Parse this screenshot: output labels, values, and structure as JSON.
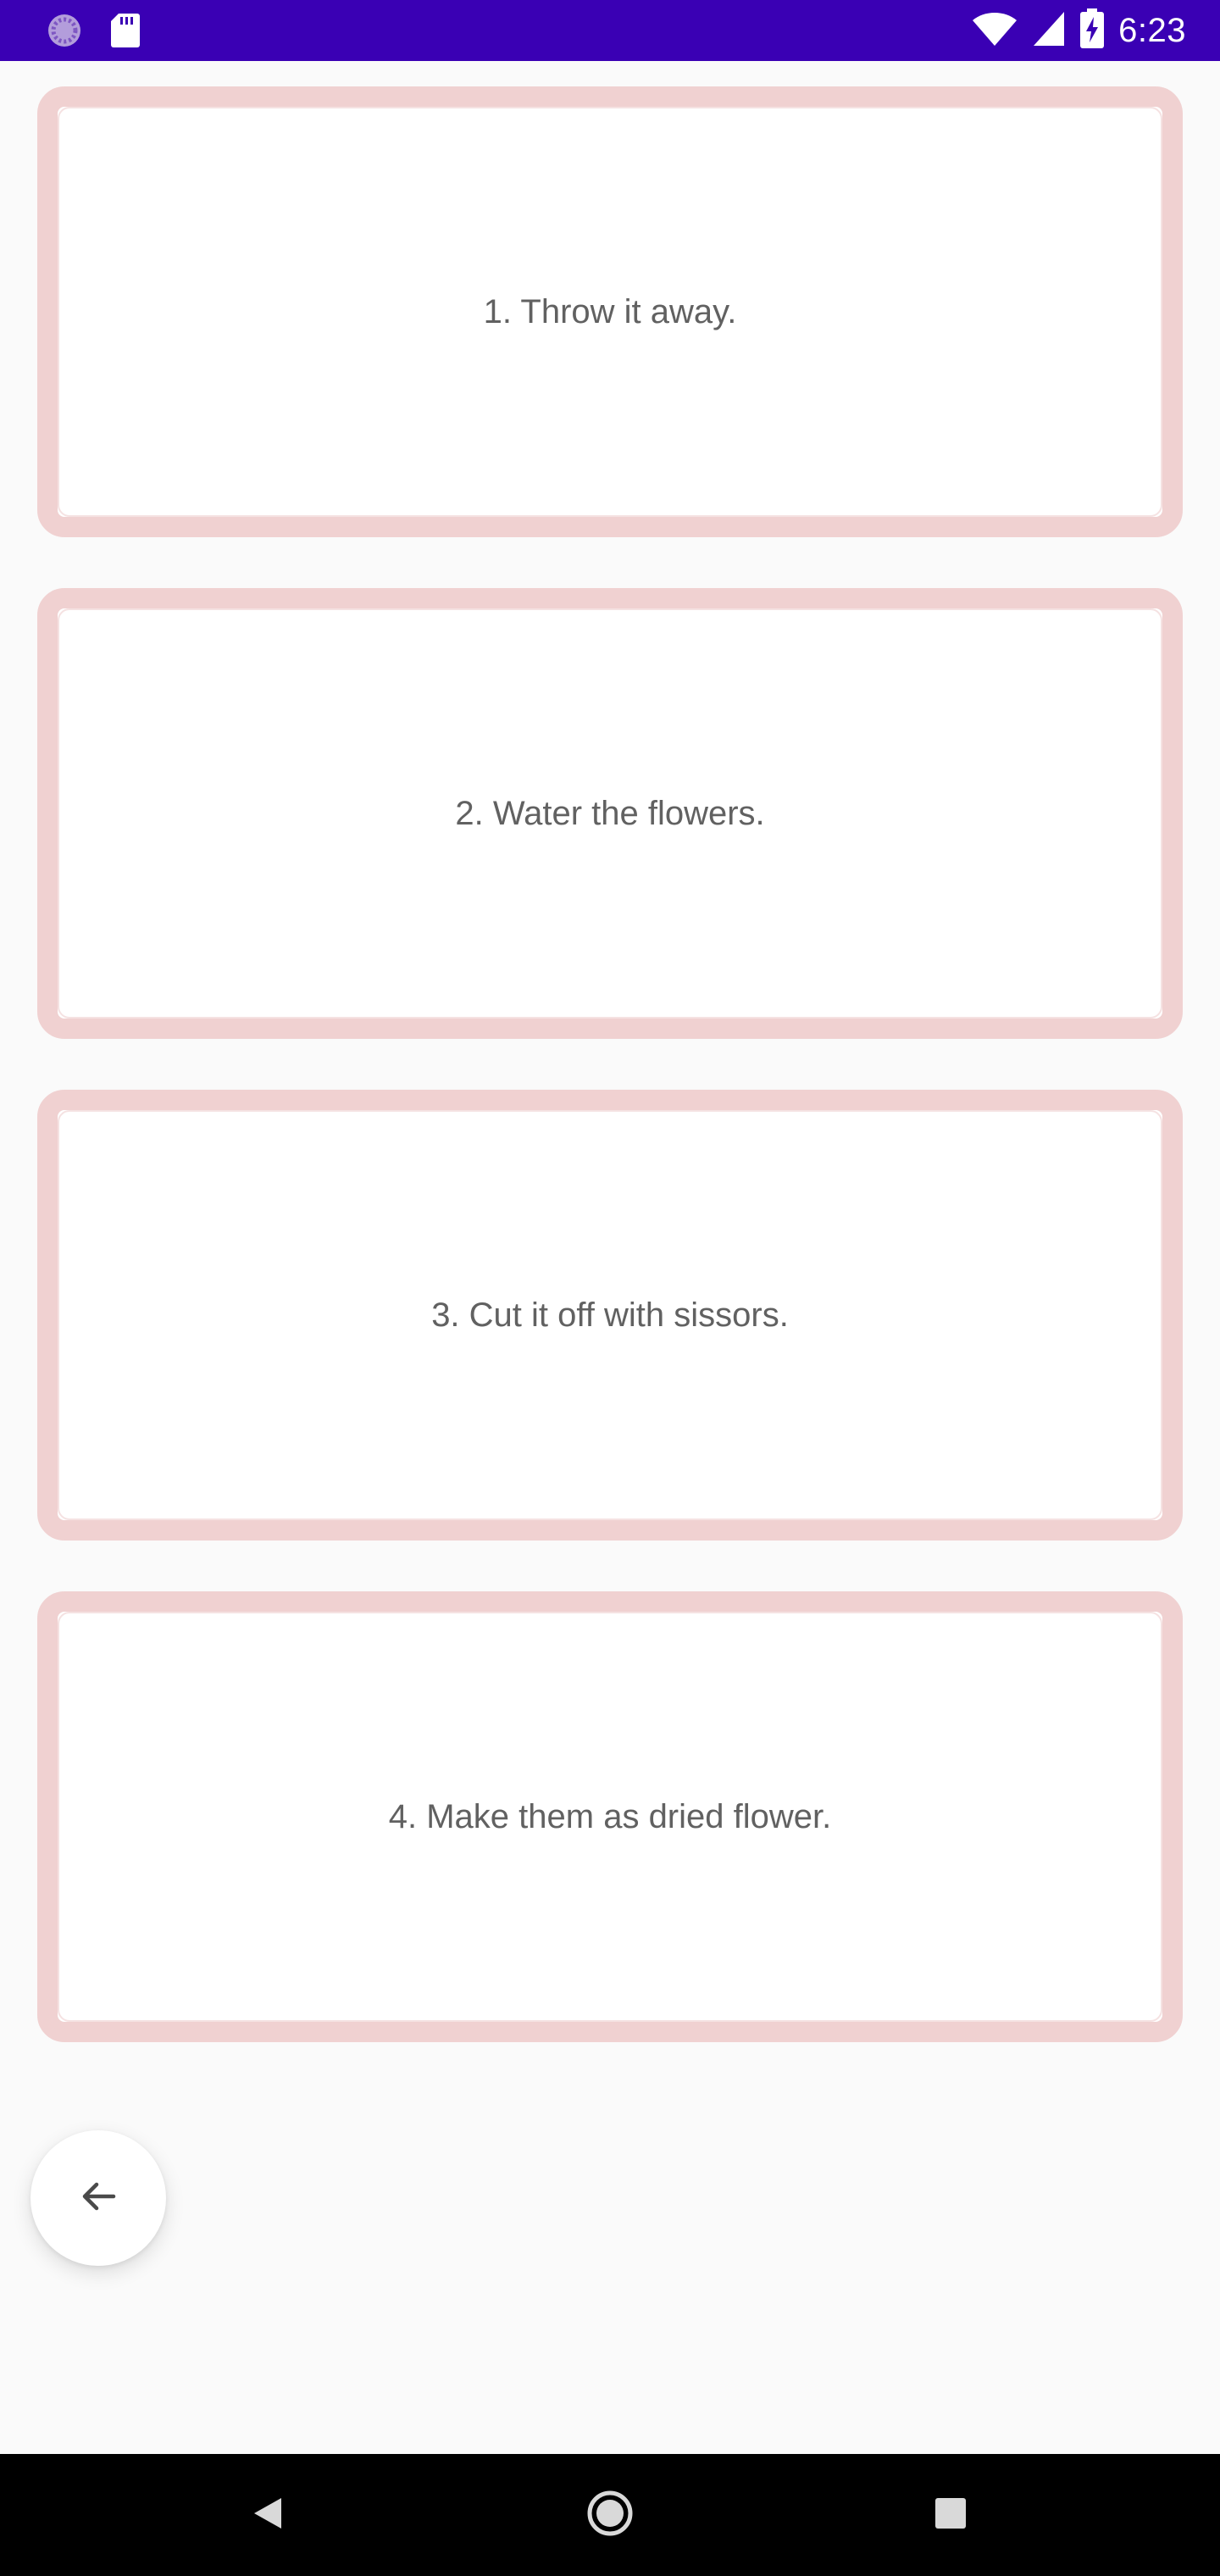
{
  "status_bar": {
    "time": "6:23",
    "background_color": "#3a00b4",
    "icons": [
      "app-notification-icon",
      "sd-card-icon",
      "wifi-icon",
      "signal-icon",
      "battery-charging-icon"
    ]
  },
  "cards": [
    {
      "label": "1. Throw it away."
    },
    {
      "label": "2. Water the flowers."
    },
    {
      "label": "3. Cut it off with sissors."
    },
    {
      "label": "4. Make them as dried flower."
    }
  ],
  "card_border_color": "#f0d1d1",
  "fab": {
    "icon": "arrow-left-icon"
  },
  "nav_bar": {
    "buttons": [
      "back-triangle-icon",
      "home-circle-icon",
      "recents-square-icon"
    ]
  }
}
